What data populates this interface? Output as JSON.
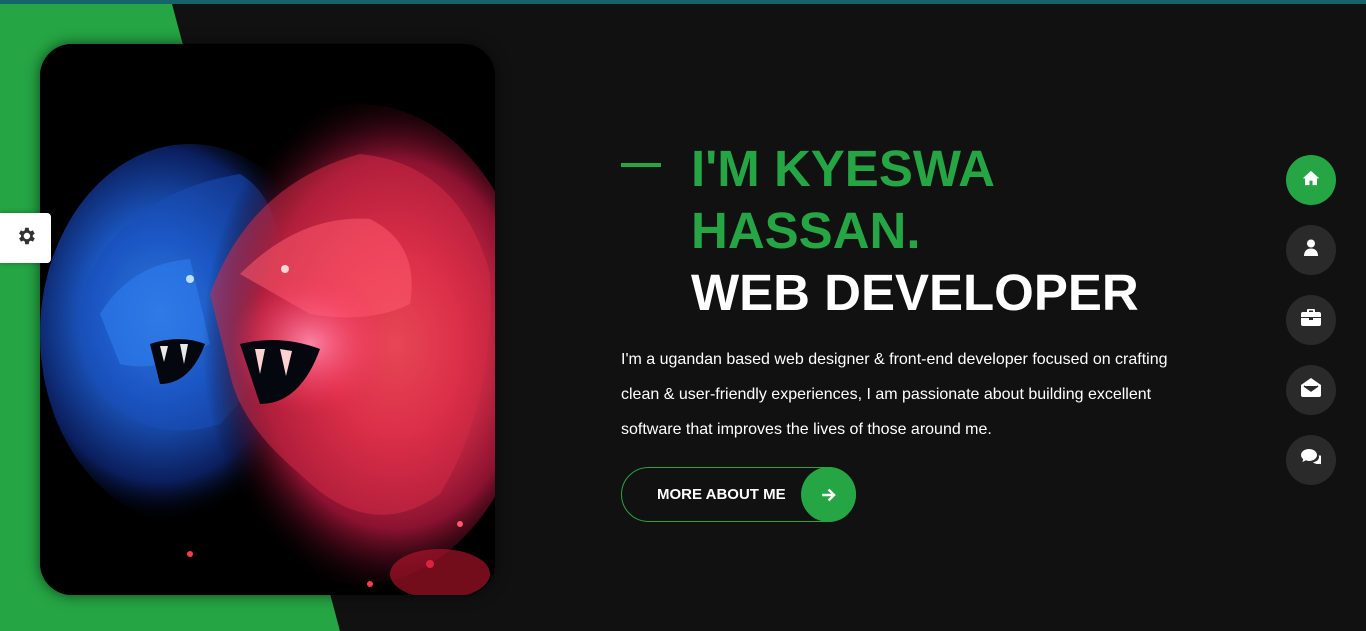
{
  "hero": {
    "name_line": "I'M KYESWA HASSAN.",
    "role_line": "WEB DEVELOPER",
    "description": "I'm a ugandan based web designer & front-end developer focused on crafting clean & user-friendly experiences, I am passionate about building excellent software that improves the lives of those around me.",
    "cta_label": "MORE ABOUT ME"
  },
  "icons": {
    "settings": "gear-icon",
    "cta": "arrow-right-icon",
    "nav": [
      "home-icon",
      "user-icon",
      "briefcase-icon",
      "envelope-open-icon",
      "comments-icon"
    ]
  },
  "side_nav": {
    "active_index": 0,
    "items": [
      "home",
      "about",
      "portfolio",
      "contact",
      "blog"
    ]
  },
  "colors": {
    "accent": "#25a544",
    "background": "#111111",
    "nav_button": "#2b2a2a",
    "top_line": "#15636b"
  }
}
